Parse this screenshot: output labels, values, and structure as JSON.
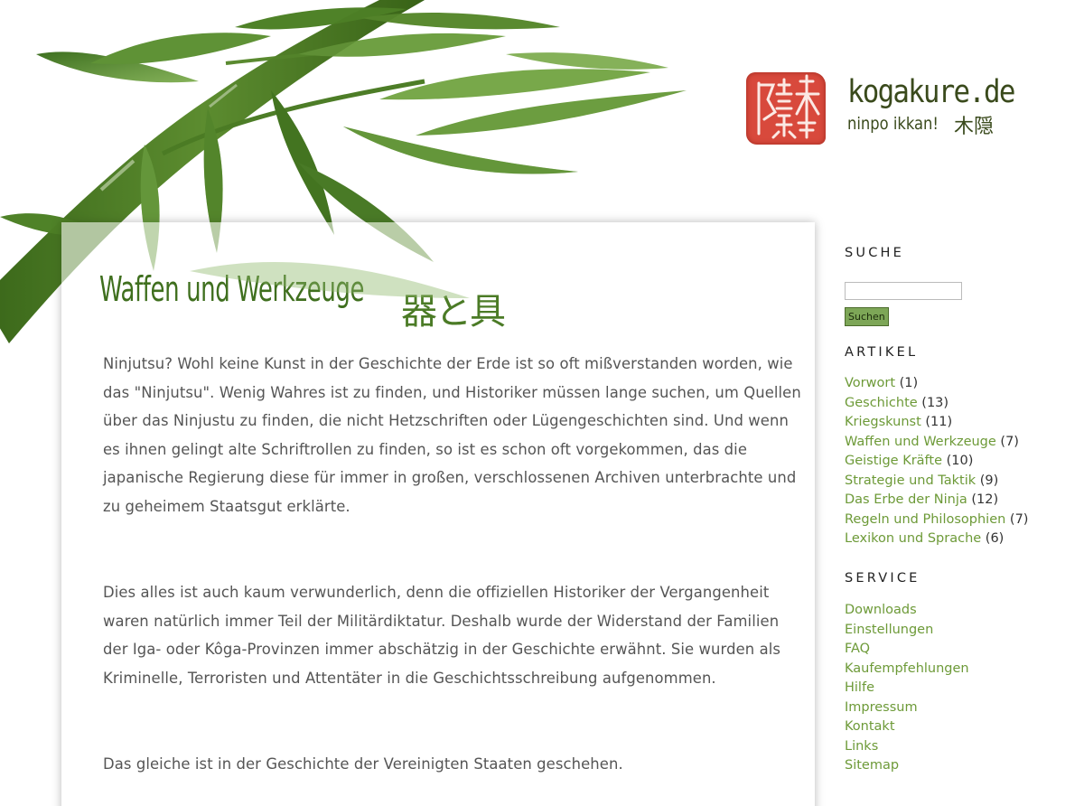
{
  "header": {
    "site_name": "kogakure.de",
    "tagline": "ninpo ikkan!",
    "tagline_kanji": "木隠"
  },
  "article": {
    "title": "Waffen und Werkzeuge",
    "title_kanji": "器と具",
    "paragraphs": [
      "Ninjutsu? Wohl keine Kunst in der Geschichte der Erde ist so oft mißverstanden worden, wie das \"Ninjutsu\". Wenig Wahres ist zu finden, und Historiker müssen lange suchen, um Quellen über das Ninjustu zu finden, die nicht Hetzschriften oder Lügengeschichten sind. Und wenn es ihnen gelingt alte Schriftrollen zu finden, so ist es schon oft vorgekommen, das die japanische Regierung diese für  immer in großen, verschlossenen Archiven unterbrachte und zu geheimem Staatsgut erklärte.",
      "Dies alles ist auch kaum verwunderlich, denn die offiziellen Historiker der Vergangenheit waren natürlich immer Teil der Militärdiktatur. Deshalb wurde der Widerstand der Familien der Iga- oder Kôga-Provinzen immer abschätzig in der Geschichte erwähnt. Sie wurden als Kriminelle, Terroristen und Attentäter in die Geschichtsschreibung aufgenommen.",
      "Das gleiche ist in der Geschichte der Vereinigten Staaten geschehen."
    ]
  },
  "sidebar": {
    "search": {
      "heading": "SUCHE",
      "placeholder": "",
      "value": "",
      "button_label": "Suchen"
    },
    "articles": {
      "heading": "ARTIKEL",
      "items": [
        {
          "label": "Vorwort",
          "count": "(1)"
        },
        {
          "label": "Geschichte",
          "count": "(13)"
        },
        {
          "label": "Kriegskunst",
          "count": "(11)"
        },
        {
          "label": "Waffen und Werkzeuge",
          "count": "(7)"
        },
        {
          "label": "Geistige Kräfte",
          "count": "(10)"
        },
        {
          "label": "Strategie und Taktik",
          "count": "(9)"
        },
        {
          "label": "Das Erbe der Ninja",
          "count": "(12)"
        },
        {
          "label": "Regeln und Philosophien",
          "count": "(7)"
        },
        {
          "label": "Lexikon und Sprache",
          "count": "(6)"
        }
      ]
    },
    "service": {
      "heading": "SERVICE",
      "items": [
        {
          "label": "Downloads"
        },
        {
          "label": "Einstellungen"
        },
        {
          "label": "FAQ"
        },
        {
          "label": "Kaufempfehlungen"
        },
        {
          "label": "Hilfe"
        },
        {
          "label": "Impressum"
        },
        {
          "label": "Kontakt"
        },
        {
          "label": "Links"
        },
        {
          "label": "Sitemap"
        }
      ]
    }
  },
  "colors": {
    "link": "#6d9a38",
    "title": "#3f6f1e",
    "body_text": "#555555",
    "seal": "#d8493c",
    "logo_text": "#3a4a1c"
  }
}
